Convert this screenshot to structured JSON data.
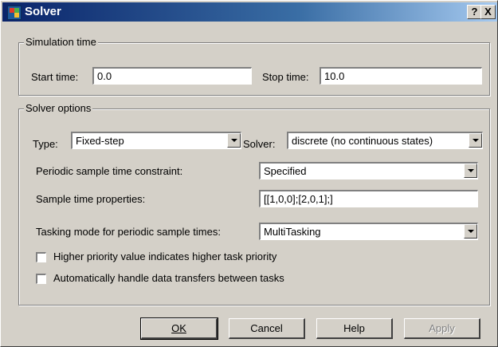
{
  "window": {
    "title": "Solver",
    "help_button": "?",
    "close_button": "X"
  },
  "simulation_time": {
    "legend": "Simulation time",
    "start_label": "Start time:",
    "start_value": "0.0",
    "stop_label": "Stop time:",
    "stop_value": "10.0"
  },
  "solver_options": {
    "legend": "Solver options",
    "type_label": "Type:",
    "type_value": "Fixed-step",
    "solver_label": "Solver:",
    "solver_value": "discrete (no continuous states)",
    "periodic_label": "Periodic sample time constraint:",
    "periodic_value": "Specified",
    "sample_props_label": "Sample time properties:",
    "sample_props_value": "[[1,0,0];[2,0,1];]",
    "tasking_label": "Tasking mode for periodic sample times:",
    "tasking_value": "MultiTasking",
    "checkbox1_label": "Higher priority value indicates higher task priority",
    "checkbox1_checked": false,
    "checkbox2_label": "Automatically handle data transfers between tasks",
    "checkbox2_checked": false
  },
  "buttons": {
    "ok": "OK",
    "cancel": "Cancel",
    "help": "Help",
    "apply": "Apply"
  }
}
